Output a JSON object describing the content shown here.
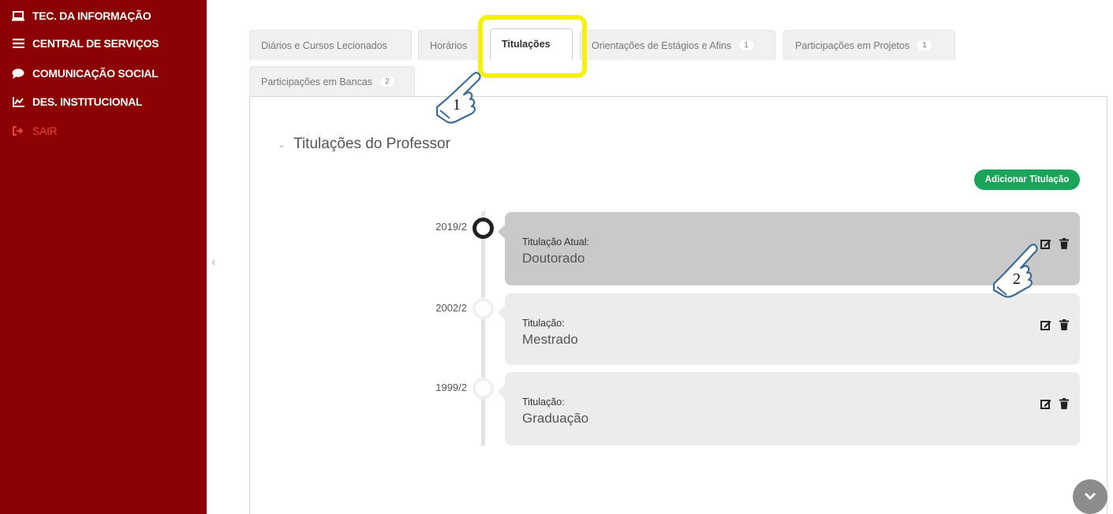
{
  "sidebar": {
    "items": [
      {
        "label": "TEC. DA INFORMAÇÃO",
        "icon": "laptop-icon"
      },
      {
        "label": "CENTRAL DE SERVIÇOS",
        "icon": "list-icon"
      },
      {
        "label": "COMUNICAÇÃO SOCIAL",
        "icon": "chat-bubble-icon"
      },
      {
        "label": "DES. INSTITUCIONAL",
        "icon": "chart-icon"
      },
      {
        "label": "SAIR",
        "icon": "logout-icon"
      }
    ]
  },
  "tabs": [
    {
      "label": "Diários e Cursos Lecionados"
    },
    {
      "label": "Horários"
    },
    {
      "label": "Titulações",
      "active": true
    },
    {
      "label": "Orientações de Estágios e Afins",
      "count": "1"
    },
    {
      "label": "Participações em Projetos",
      "count": "1"
    },
    {
      "label": "Participações em Bancas",
      "count": "2"
    }
  ],
  "section": {
    "title": "Titulações do Professor"
  },
  "add_button": {
    "label": "Adicionar Titulação"
  },
  "timeline": [
    {
      "year": "2019/2",
      "label": "Titulação Atual:",
      "value": "Doutorado",
      "current": true
    },
    {
      "year": "2002/2",
      "label": "Titulação:",
      "value": "Mestrado"
    },
    {
      "year": "1999/2",
      "label": "Titulação:",
      "value": "Graduação"
    }
  ],
  "annotations": {
    "step1": "1",
    "step2": "2"
  },
  "colors": {
    "sidebar": "#8b0000",
    "highlight": "#f5f10f",
    "add_button": "#1aa45a",
    "logout": "#e8453c"
  }
}
